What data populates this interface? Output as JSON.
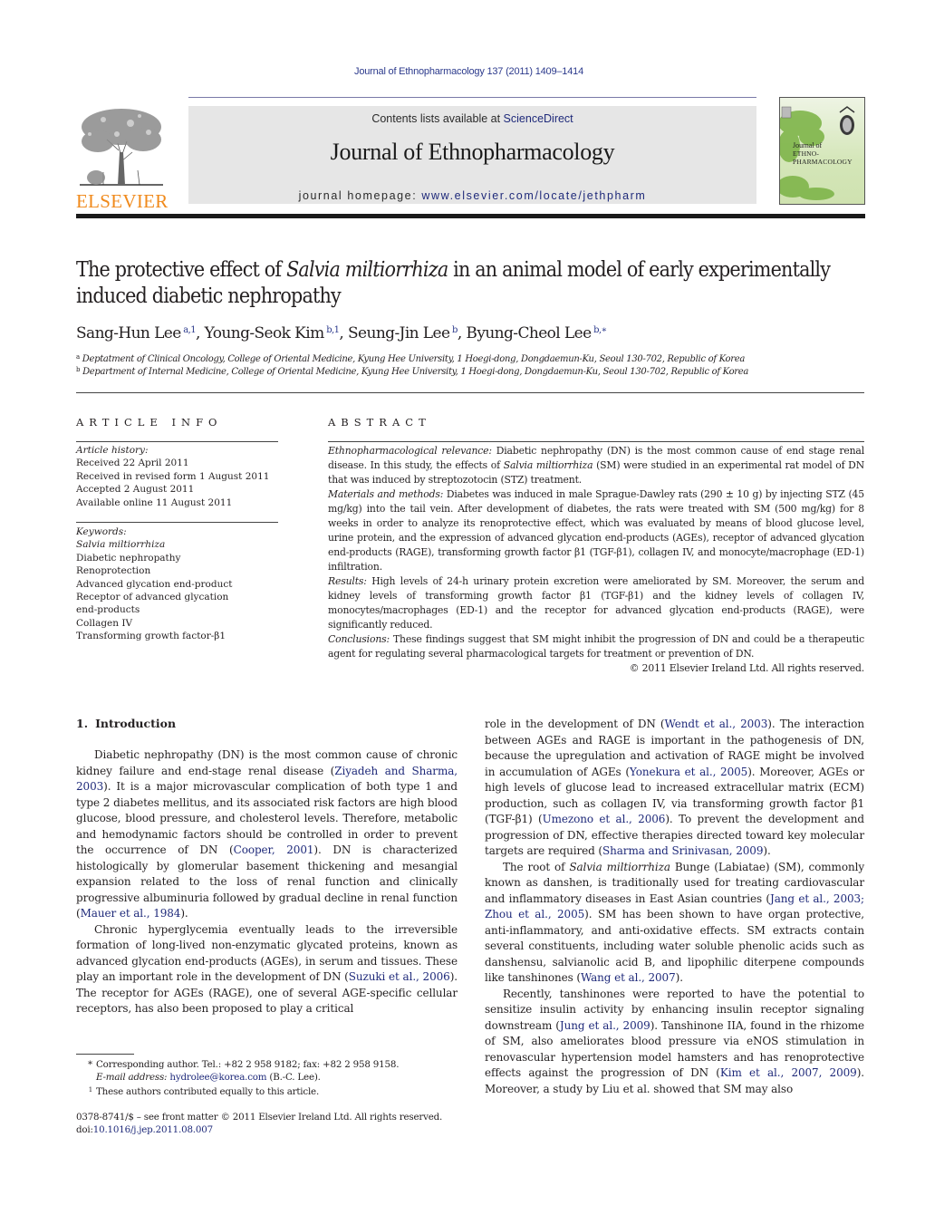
{
  "header": {
    "journal_reference": "Journal of Ethnopharmacology 137 (2011) 1409–1414",
    "contents_prefix": "Contents lists available at ",
    "contents_link": "ScienceDirect",
    "journal_title": "Journal of Ethnopharmacology",
    "homepage_prefix": "journal homepage: ",
    "homepage_url": "www.elsevier.com/locate/jethpharm",
    "publisher_logo_text": "ELSEVIER",
    "publisher_logo_icon": "elsevier-tree-icon",
    "cover_thumbnail": {
      "line1": "Journal of",
      "line2": "ETHNO-",
      "line3": "PHARMACOLOGY"
    },
    "colors": {
      "link": "#1f2a7a",
      "publisher_orange": "#f08a1c",
      "masthead_bg": "#e6e6e6"
    }
  },
  "article": {
    "title_part1": "The protective effect of ",
    "title_italic": "Salvia miltiorrhiza",
    "title_part2": " in an animal model of early experimentally induced diabetic nephropathy",
    "authors": [
      {
        "name": "Sang-Hun Lee",
        "sup": "a,1",
        "sep": ", "
      },
      {
        "name": "Young-Seok Kim",
        "sup": "b,1",
        "sep": ", "
      },
      {
        "name": "Seung-Jin Lee",
        "sup": "b",
        "sep": ", "
      },
      {
        "name": "Byung-Cheol Lee",
        "sup": "b,∗",
        "sep": ""
      }
    ],
    "affiliations": [
      {
        "mark": "a",
        "text": "Deptatment of Clinical Oncology, College of Oriental Medicine, Kyung Hee University, 1 Hoegi-dong, Dongdaemun-Ku, Seoul 130-702, Republic of Korea"
      },
      {
        "mark": "b",
        "text": "Department of Internal Medicine, College of Oriental Medicine, Kyung Hee University, 1 Hoegi-dong, Dongdaemun-Ku, Seoul 130-702, Republic of Korea"
      }
    ]
  },
  "article_info": {
    "heading": "ARTICLE INFO",
    "history_label": "Article history:",
    "history": [
      "Received 22 April 2011",
      "Received in revised form 1 August 2011",
      "Accepted 2 August 2011",
      "Available online 11 August 2011"
    ],
    "keywords_label": "Keywords:",
    "keywords": [
      "Salvia miltiorrhiza",
      "Diabetic nephropathy",
      "Renoprotection",
      "Advanced glycation end-product",
      "Receptor of advanced glycation",
      "end-products",
      "Collagen IV",
      "Transforming growth factor-β1"
    ]
  },
  "abstract": {
    "heading": "ABSTRACT",
    "relevance_label": "Ethnopharmacological relevance:",
    "relevance_a": " Diabetic nephropathy (DN) is the most common cause of end stage renal disease. In this study, the effects of ",
    "relevance_italic": "Salvia miltiorrhiza",
    "relevance_b": " (SM) were studied in an experimental rat model of DN that was induced by streptozotocin (STZ) treatment.",
    "methods_label": "Materials and methods:",
    "methods": " Diabetes was induced in male Sprague-Dawley rats (290 ± 10 g) by injecting STZ (45 mg/kg) into the tail vein. After development of diabetes, the rats were treated with SM (500 mg/kg) for 8 weeks in order to analyze its renoprotective effect, which was evaluated by means of blood glucose level, urine protein, and the expression of advanced glycation end-products (AGEs), receptor of advanced glycation end-products (RAGE), transforming growth factor β1 (TGF-β1), collagen IV, and monocyte/macrophage (ED-1) infiltration.",
    "results_label": "Results:",
    "results": " High levels of 24-h urinary protein excretion were ameliorated by SM. Moreover, the serum and kidney levels of transforming growth factor β1 (TGF-β1) and the kidney levels of collagen IV, monocytes/macrophages (ED-1) and the receptor for advanced glycation end-products (RAGE), were significantly reduced.",
    "conclusions_label": "Conclusions:",
    "conclusions": " These findings suggest that SM might inhibit the progression of DN and could be a therapeutic agent for regulating several pharmacological targets for treatment or prevention of DN.",
    "copyright": "© 2011 Elsevier Ireland Ltd. All rights reserved."
  },
  "introduction": {
    "number": "1.",
    "heading": "Introduction",
    "p1": [
      {
        "t": "Diabetic nephropathy (DN) is the most common cause of chronic kidney failure and end-stage renal disease ("
      },
      {
        "c": "Ziyadeh and Sharma, 2003"
      },
      {
        "t": "). It is a major microvascular complication of both type 1 and type 2 diabetes mellitus, and its associated risk factors are high blood glucose, blood pressure, and cholesterol levels. Therefore, metabolic and hemodynamic factors should be controlled in order to prevent the occurrence of DN ("
      },
      {
        "c": "Cooper, 2001"
      },
      {
        "t": "). DN is characterized histologically by glomerular basement thickening and mesangial expansion related to the loss of renal function and clinically progressive albuminuria followed by gradual decline in renal function ("
      },
      {
        "c": "Mauer et al., 1984"
      },
      {
        "t": ")."
      }
    ],
    "p2": [
      {
        "t": "Chronic hyperglycemia eventually leads to the irreversible formation of long-lived non-enzymatic glycated proteins, known as advanced glycation end-products (AGEs), in serum and tissues. These play an important role in the development of DN ("
      },
      {
        "c": "Suzuki et al., 2006"
      },
      {
        "t": "). The receptor for AGEs (RAGE), one of several AGE-specific cellular receptors, has also been proposed to play a critical"
      }
    ],
    "p3": [
      {
        "t": "role in the development of DN ("
      },
      {
        "c": "Wendt et al., 2003"
      },
      {
        "t": "). The interaction between AGEs and RAGE is important in the pathogenesis of DN, because the upregulation and activation of RAGE might be involved in accumulation of AGEs ("
      },
      {
        "c": "Yonekura et al., 2005"
      },
      {
        "t": "). Moreover, AGEs or high levels of glucose lead to increased extracellular matrix (ECM) production, such as collagen IV, via transforming growth factor β1 (TGF-β1) ("
      },
      {
        "c": "Umezono et al., 2006"
      },
      {
        "t": "). To prevent the development and progression of DN, effective therapies directed toward key molecular targets are required ("
      },
      {
        "c": "Sharma and Srinivasan, 2009"
      },
      {
        "t": ")."
      }
    ],
    "p4": [
      {
        "t": "The root of "
      },
      {
        "i": "Salvia miltiorrhiza"
      },
      {
        "t": " Bunge (Labiatae) (SM), commonly known as danshen, is traditionally used for treating cardiovascular and inflammatory diseases in East Asian countries ("
      },
      {
        "c": "Jang et al., 2003; Zhou et al., 2005"
      },
      {
        "t": "). SM has been shown to have organ protective, anti-inflammatory, and anti-oxidative effects. SM extracts contain several constituents, including water soluble phenolic acids such as danshensu, salvianolic acid B, and lipophilic diterpene compounds like tanshinones ("
      },
      {
        "c": "Wang et al., 2007"
      },
      {
        "t": ")."
      }
    ],
    "p5": [
      {
        "t": "Recently, tanshinones were reported to have the potential to sensitize insulin activity by enhancing insulin receptor signaling downstream ("
      },
      {
        "c": "Jung et al., 2009"
      },
      {
        "t": "). Tanshinone IIA, found in the rhizome of SM, also ameliorates blood pressure via eNOS stimulation in renovascular hypertension model hamsters and has renoprotective effects against the progression of DN ("
      },
      {
        "c": "Kim et al., 2007, 2009"
      },
      {
        "t": "). Moreover, a study by Liu et al. showed that SM may also"
      }
    ]
  },
  "footnotes": {
    "corresponding_mark": "*",
    "corresponding": "Corresponding author. Tel.: +82 2 958 9182; fax: +82 2 958 9158.",
    "email_label": "E-mail address:",
    "email": "hydrolee@korea.com",
    "email_suffix": " (B.-C. Lee).",
    "equal_mark": "1",
    "equal": "These authors contributed equally to this article.",
    "front_matter": "0378-8741/$ – see front matter © 2011 Elsevier Ireland Ltd. All rights reserved.",
    "doi_prefix": "doi:",
    "doi": "10.1016/j.jep.2011.08.007"
  }
}
